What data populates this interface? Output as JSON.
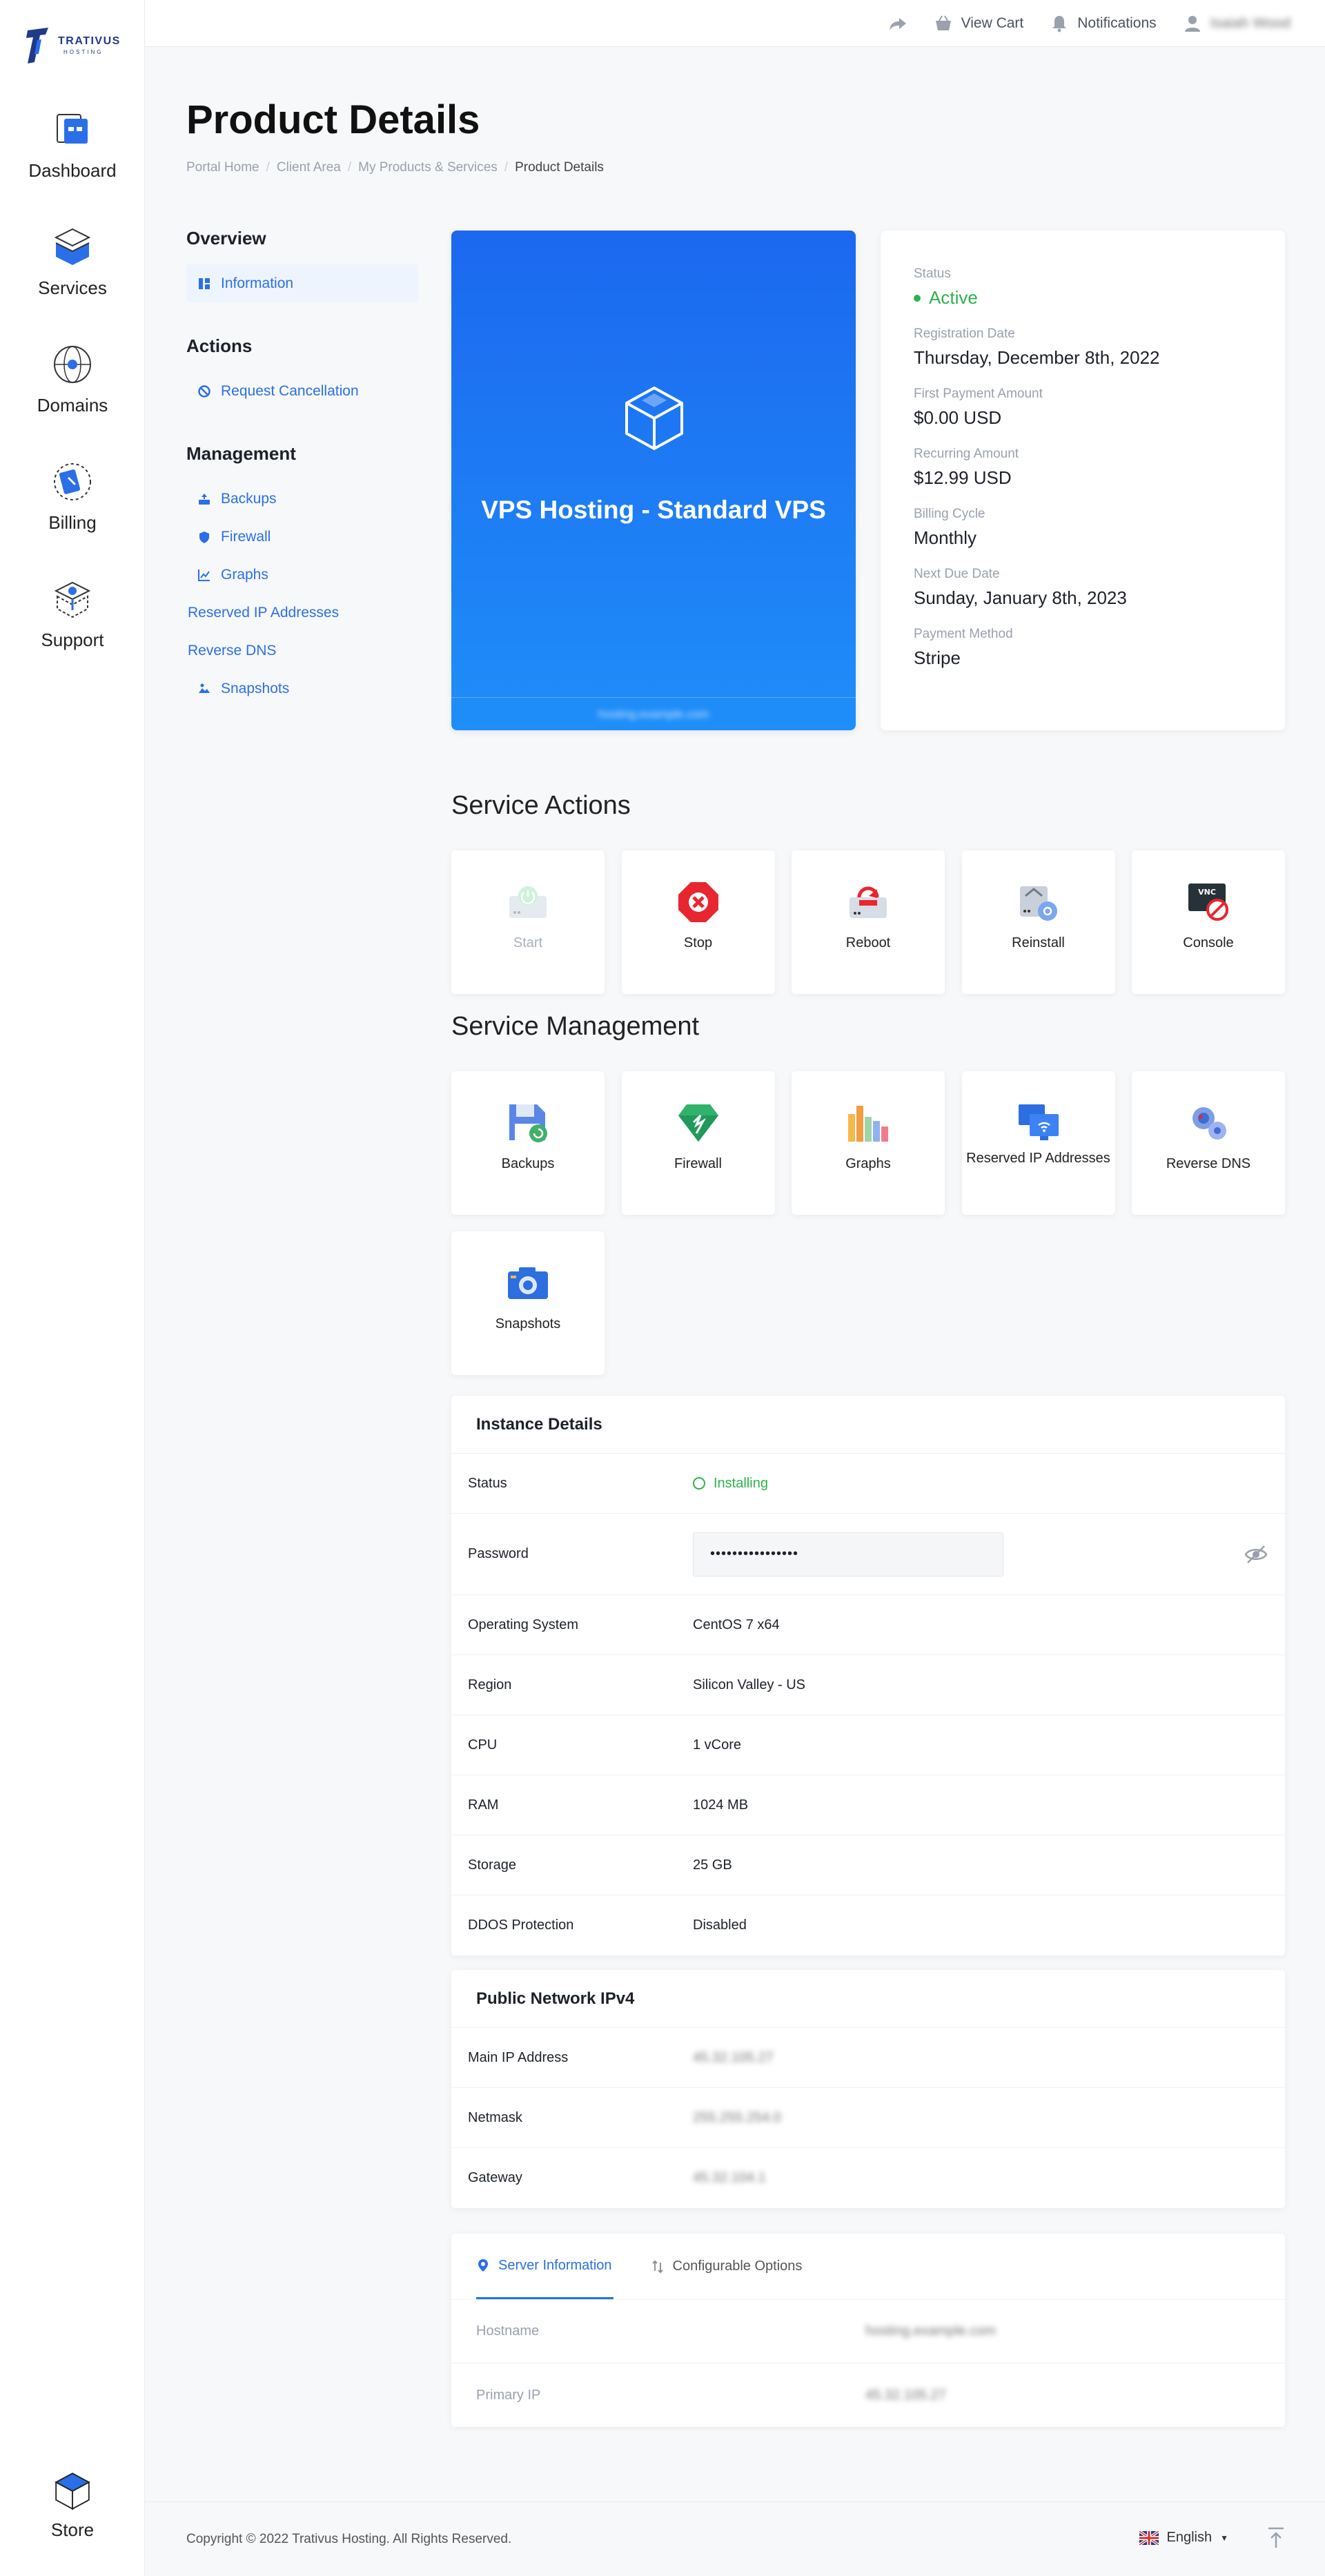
{
  "brand": {
    "name": "TRATIVUS",
    "sub": "HOSTING"
  },
  "leftnav": [
    {
      "label": "Dashboard",
      "icon": "dashboard-icon"
    },
    {
      "label": "Services",
      "icon": "services-box-icon"
    },
    {
      "label": "Domains",
      "icon": "domains-globe-icon"
    },
    {
      "label": "Billing",
      "icon": "billing-icon"
    },
    {
      "label": "Support",
      "icon": "support-icon"
    }
  ],
  "store": {
    "label": "Store",
    "icon": "store-box-icon"
  },
  "topbar": {
    "view_cart": "View Cart",
    "notifications": "Notifications",
    "user_name": "Isaiah Wood"
  },
  "page": {
    "title": "Product Details",
    "breadcrumb": [
      "Portal Home",
      "Client Area",
      "My Products & Services",
      "Product Details"
    ]
  },
  "side": {
    "overview": "Overview",
    "information": "Information",
    "actions": "Actions",
    "request_cancellation": "Request Cancellation",
    "management": "Management",
    "links": [
      "Backups",
      "Firewall",
      "Graphs",
      "Reserved IP Addresses",
      "Reverse DNS",
      "Snapshots"
    ]
  },
  "product": {
    "title": "VPS Hosting - Standard VPS",
    "domain": "hosting.example.com"
  },
  "info": {
    "status_label": "Status",
    "status_value": "Active",
    "reg_label": "Registration Date",
    "reg_value": "Thursday, December 8th, 2022",
    "first_label": "First Payment Amount",
    "first_value": "$0.00 USD",
    "recur_label": "Recurring Amount",
    "recur_value": "$12.99 USD",
    "cycle_label": "Billing Cycle",
    "cycle_value": "Monthly",
    "due_label": "Next Due Date",
    "due_value": "Sunday, January 8th, 2023",
    "pay_label": "Payment Method",
    "pay_value": "Stripe"
  },
  "service_actions": {
    "title": "Service Actions",
    "items": [
      "Start",
      "Stop",
      "Reboot",
      "Reinstall",
      "Console"
    ]
  },
  "service_management": {
    "title": "Service Management",
    "items": [
      "Backups",
      "Firewall",
      "Graphs",
      "Reserved IP Addresses",
      "Reverse DNS",
      "Snapshots"
    ]
  },
  "instance": {
    "title": "Instance Details",
    "rows": [
      {
        "k": "Status",
        "v": "Installing"
      },
      {
        "k": "Password",
        "v": "••••••••••••••••"
      },
      {
        "k": "Operating System",
        "v": "CentOS 7 x64"
      },
      {
        "k": "Region",
        "v": "Silicon Valley - US"
      },
      {
        "k": "CPU",
        "v": "1 vCore"
      },
      {
        "k": "RAM",
        "v": "1024 MB"
      },
      {
        "k": "Storage",
        "v": "25 GB"
      },
      {
        "k": "DDOS Protection",
        "v": "Disabled"
      }
    ]
  },
  "network": {
    "title": "Public Network IPv4",
    "rows": [
      {
        "k": "Main IP Address",
        "v": "45.32.105.27"
      },
      {
        "k": "Netmask",
        "v": "255.255.254.0"
      },
      {
        "k": "Gateway",
        "v": "45.32.104.1"
      }
    ]
  },
  "server_tabs": {
    "tab1": "Server Information",
    "tab2": "Configurable Options",
    "rows": [
      {
        "k": "Hostname",
        "v": "hosting.example.com"
      },
      {
        "k": "Primary IP",
        "v": "45.32.105.27"
      }
    ]
  },
  "footer": {
    "copyright": "Copyright © 2022 Trativus Hosting. All Rights Reserved.",
    "language": "English"
  },
  "colors": {
    "accent": "#2a6fe8",
    "success": "#2bb24c",
    "card_gradient_top": "#1c68ef",
    "card_gradient_bottom": "#1f8ef9"
  }
}
